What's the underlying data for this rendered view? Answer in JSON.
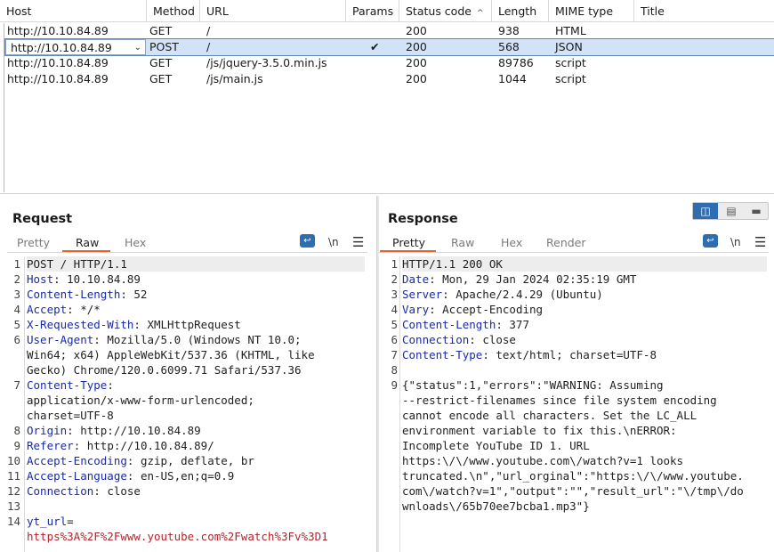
{
  "history": {
    "columns": [
      "Host",
      "Method",
      "URL",
      "Params",
      "Status code",
      "Length",
      "MIME type",
      "Title"
    ],
    "sort_indicator": "^",
    "selected_host": "http://10.10.84.89",
    "rows": [
      {
        "host": "http://10.10.84.89",
        "method": "GET",
        "url": "/",
        "params": "",
        "status": "200",
        "length": "938",
        "mime": "HTML",
        "title": ""
      },
      {
        "host": "http://10.10.84.89",
        "method": "POST",
        "url": "/",
        "params": "✔",
        "status": "200",
        "length": "568",
        "mime": "JSON",
        "title": ""
      },
      {
        "host": "http://10.10.84.89",
        "method": "GET",
        "url": "/js/jquery-3.5.0.min.js",
        "params": "",
        "status": "200",
        "length": "89786",
        "mime": "script",
        "title": ""
      },
      {
        "host": "http://10.10.84.89",
        "method": "GET",
        "url": "/js/main.js",
        "params": "",
        "status": "200",
        "length": "1044",
        "mime": "script",
        "title": ""
      }
    ]
  },
  "request": {
    "title": "Request",
    "tabs": [
      "Pretty",
      "Raw",
      "Hex"
    ],
    "active_tab": "Raw",
    "newline_label": "\\n",
    "menu_icon": "hamburger-icon",
    "line_numbers": [
      "1",
      "2",
      "3",
      "4",
      "5",
      "6",
      "7",
      "8",
      "9",
      "10",
      "11",
      "12",
      "13",
      "14"
    ],
    "lines": [
      {
        "k": "",
        "v": "POST / HTTP/1.1"
      },
      {
        "k": "Host",
        "v": ": 10.10.84.89"
      },
      {
        "k": "Content-Length",
        "v": ": 52"
      },
      {
        "k": "Accept",
        "v": ": */*"
      },
      {
        "k": "X-Requested-With",
        "v": ": XMLHttpRequest"
      },
      {
        "k": "User-Agent",
        "v": ": Mozilla/5.0 (Windows NT 10.0;"
      },
      {
        "k": "",
        "v": "Win64; x64) AppleWebKit/537.36 (KHTML, like"
      },
      {
        "k": "",
        "v": "Gecko) Chrome/120.0.6099.71 Safari/537.36"
      },
      {
        "k": "Content-Type",
        "v": ":"
      },
      {
        "k": "",
        "v": "application/x-www-form-urlencoded;"
      },
      {
        "k": "",
        "v": "charset=UTF-8"
      },
      {
        "k": "Origin",
        "v": ": http://10.10.84.89"
      },
      {
        "k": "Referer",
        "v": ": http://10.10.84.89/"
      },
      {
        "k": "Accept-Encoding",
        "v": ": gzip, deflate, br"
      },
      {
        "k": "Accept-Language",
        "v": ": en-US,en;q=0.9"
      },
      {
        "k": "Connection",
        "v": ": close"
      },
      {
        "k": "",
        "v": ""
      },
      {
        "k": "yt_url",
        "v": "="
      },
      {
        "k": "",
        "v": "",
        "pv": "https%3A%2F%2Fwww.youtube.com%2Fwatch%3Fv%3D1"
      }
    ]
  },
  "response": {
    "title": "Response",
    "tabs": [
      "Pretty",
      "Raw",
      "Hex",
      "Render"
    ],
    "active_tab": "Pretty",
    "newline_label": "\\n",
    "line_numbers": [
      "1",
      "2",
      "3",
      "4",
      "5",
      "6",
      "7",
      "8",
      "9"
    ],
    "lines": [
      {
        "k": "",
        "v": "HTTP/1.1 200 OK"
      },
      {
        "k": "Date",
        "v": ": Mon, 29 Jan 2024 02:35:19 GMT"
      },
      {
        "k": "Server",
        "v": ": Apache/2.4.29 (Ubuntu)"
      },
      {
        "k": "Vary",
        "v": ": Accept-Encoding"
      },
      {
        "k": "Content-Length",
        "v": ": 377"
      },
      {
        "k": "Connection",
        "v": ": close"
      },
      {
        "k": "Content-Type",
        "v": ": text/html; charset=UTF-8"
      },
      {
        "k": "",
        "v": ""
      },
      {
        "k": "",
        "v": "{\"status\":1,\"errors\":\"WARNING: Assuming"
      },
      {
        "k": "",
        "v": "--restrict-filenames since file system encoding"
      },
      {
        "k": "",
        "v": "cannot encode all characters. Set the LC_ALL"
      },
      {
        "k": "",
        "v": "environment variable to fix this.\\nERROR:"
      },
      {
        "k": "",
        "v": "Incomplete YouTube ID 1. URL"
      },
      {
        "k": "",
        "v": "https:\\/\\/www.youtube.com\\/watch?v=1 looks"
      },
      {
        "k": "",
        "v": "truncated.\\n\",\"url_orginal\":\"https:\\/\\/www.youtube."
      },
      {
        "k": "",
        "v": "com\\/watch?v=1\",\"output\":\"\",\"result_url\":\"\\/tmp\\/do"
      },
      {
        "k": "",
        "v": "wnloads\\/65b70ee7bcba1.mp3\"}"
      }
    ]
  },
  "view_modes": [
    "split-horizontal-icon",
    "split-vertical-icon",
    "single-pane-icon"
  ],
  "colors": {
    "accent": "#e8642c",
    "selection": "#d3e3f7",
    "key": "#1a2aa8",
    "param_value": "#b3252c",
    "button_blue": "#2f6db3"
  }
}
